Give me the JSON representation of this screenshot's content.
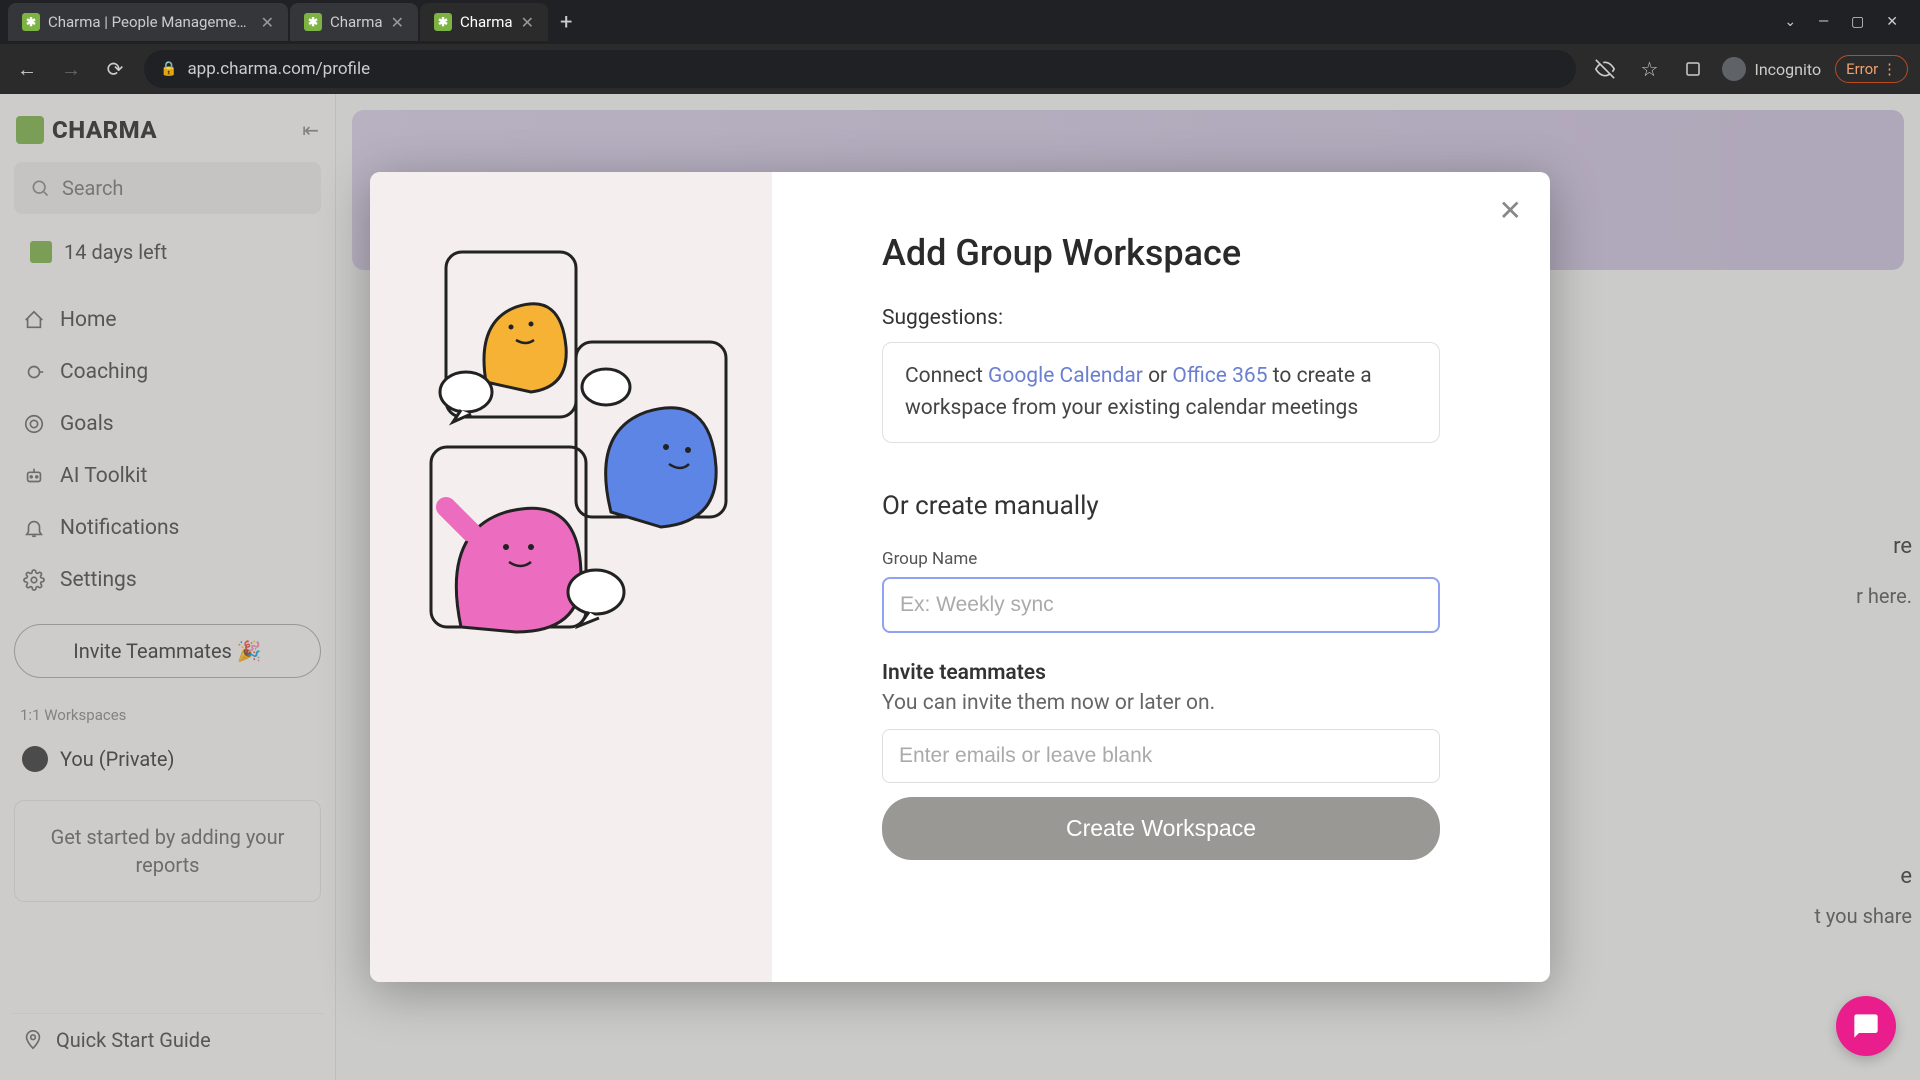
{
  "browser": {
    "tabs": [
      {
        "title": "Charma | People Management S"
      },
      {
        "title": "Charma"
      },
      {
        "title": "Charma"
      }
    ],
    "url": "app.charma.com/profile",
    "incognito_label": "Incognito",
    "error_label": "Error"
  },
  "sidebar": {
    "brand": "CHARMA",
    "search_placeholder": "Search",
    "trial": "14 days left",
    "nav": {
      "home": "Home",
      "coaching": "Coaching",
      "goals": "Goals",
      "ai": "AI Toolkit",
      "notifications": "Notifications",
      "settings": "Settings"
    },
    "invite_btn": "Invite Teammates 🎉",
    "ws_heading": "1:1 Workspaces",
    "ws_you": "You (Private)",
    "reports_card": "Get started by adding your reports",
    "quick_guide": "Quick Start Guide"
  },
  "bg": {
    "frag1": "re",
    "frag2": "r here.",
    "frag3": "e",
    "frag4": "t you share"
  },
  "modal": {
    "title": "Add Group Workspace",
    "suggest_label": "Suggestions:",
    "suggest_connect": "Connect ",
    "suggest_gcal": "Google Calendar",
    "suggest_or": " or ",
    "suggest_o365": "Office 365",
    "suggest_tail": " to create a workspace from your existing calendar meetings",
    "manual_label": "Or create manually",
    "group_name_label": "Group Name",
    "group_name_placeholder": "Ex: Weekly sync",
    "invite_title": "Invite teammates",
    "invite_sub": "You can invite them now or later on.",
    "emails_placeholder": "Enter emails or leave blank",
    "create_btn": "Create Workspace"
  }
}
